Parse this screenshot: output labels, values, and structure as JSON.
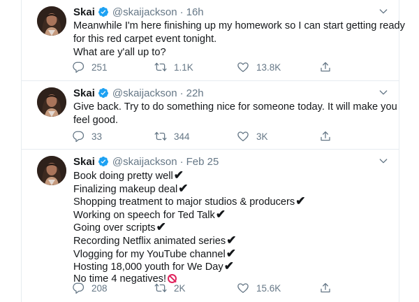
{
  "colors": {
    "accent": "#1da1f2",
    "muted": "#657786",
    "text": "#14171a",
    "divider": "#e6ecf0",
    "no_sign": "#e0245e"
  },
  "tweets": [
    {
      "name": "Skai",
      "handle": "@skaijackson",
      "dot": "·",
      "time": "16h",
      "lines": [
        "Meanwhile I'm here finishing up my homework so I can start getting ready",
        "for this red carpet event tonight.",
        "What are y'all up to?"
      ],
      "replies": "251",
      "retweets": "1.1K",
      "likes": "13.8K"
    },
    {
      "name": "Skai",
      "handle": "@skaijackson",
      "dot": "·",
      "time": "22h",
      "lines": [
        "Give back. Try to do something nice for someone today. It will make you",
        "feel good."
      ],
      "replies": "33",
      "retweets": "344",
      "likes": "3K"
    },
    {
      "name": "Skai",
      "handle": "@skaijackson",
      "dot": "·",
      "time": "Feb 25",
      "lines": [
        "Book doing pretty well",
        "Finalizing makeup deal",
        "Shopping treatment to major studios & producers",
        "Working on speech for Ted Talk",
        "Going over scripts",
        "Recording Netflix animated series",
        "Vlogging for my YouTube channel",
        "Hosting 18,000 youth for We Day",
        "No time 4 negatives!"
      ],
      "check": "✔",
      "replies": "208",
      "retweets": "2K",
      "likes": "15.6K"
    }
  ]
}
